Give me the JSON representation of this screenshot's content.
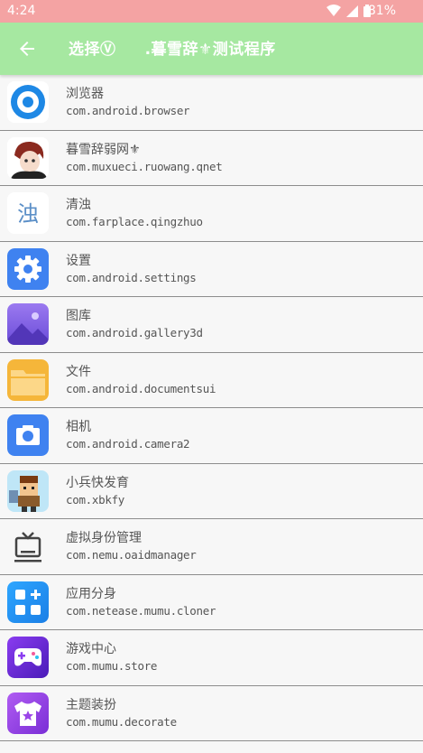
{
  "status_bar": {
    "time": "4:24",
    "battery": "81%"
  },
  "app_bar": {
    "title": "选择Ⓥ     .暮雪辞⚜测试程序"
  },
  "apps": [
    {
      "name": "浏览器",
      "package": "com.android.browser",
      "icon": "browser-icon"
    },
    {
      "name": "暮雪辞弱网⚜",
      "package": "com.muxueci.ruowang.qnet",
      "icon": "avatar-icon"
    },
    {
      "name": "清浊",
      "package": "com.farplace.qingzhuo",
      "icon": "qingzhuo-icon",
      "icon_text": "浊"
    },
    {
      "name": "设置",
      "package": "com.android.settings",
      "icon": "gear-icon"
    },
    {
      "name": "图库",
      "package": "com.android.gallery3d",
      "icon": "gallery-icon"
    },
    {
      "name": "文件",
      "package": "com.android.documentsui",
      "icon": "folder-icon"
    },
    {
      "name": "相机",
      "package": "com.android.camera2",
      "icon": "camera-icon"
    },
    {
      "name": "小兵快发育",
      "package": "com.xbkfy",
      "icon": "game-character-icon"
    },
    {
      "name": "虚拟身份管理",
      "package": "com.nemu.oaidmanager",
      "icon": "tv-icon"
    },
    {
      "name": "应用分身",
      "package": "com.netease.mumu.cloner",
      "icon": "cloner-icon"
    },
    {
      "name": "游戏中心",
      "package": "com.mumu.store",
      "icon": "gamepad-icon"
    },
    {
      "name": "主题装扮",
      "package": "com.mumu.decorate",
      "icon": "tshirt-icon"
    }
  ]
}
